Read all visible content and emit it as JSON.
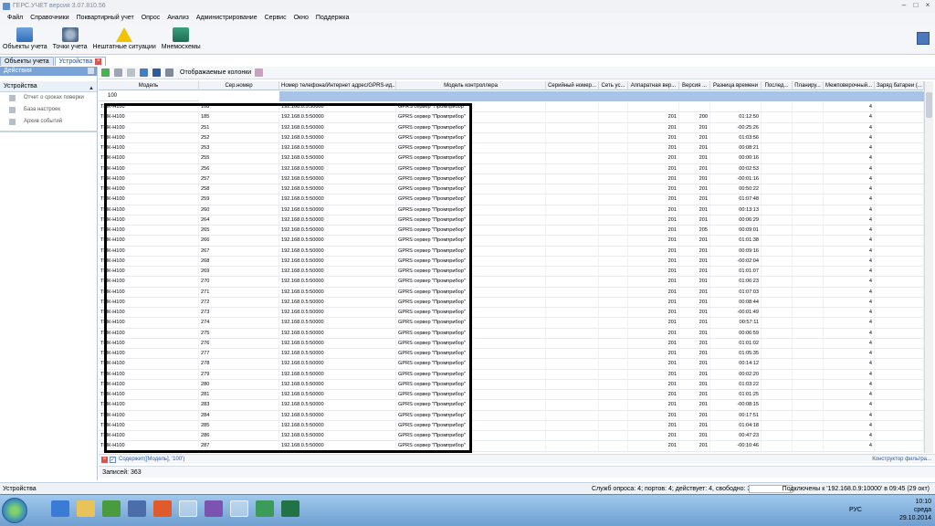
{
  "window": {
    "title": "ГЕРС.УЧЕТ версия 3.07.810.56"
  },
  "menu": [
    "Файл",
    "Справочники",
    "Поквартирный учет",
    "Опрос",
    "Анализ",
    "Администрирование",
    "Сервис",
    "Окно",
    "Поддержка"
  ],
  "toolbar": [
    {
      "label": "Объекты учета",
      "icon": "house-icon"
    },
    {
      "label": "Точки учета",
      "icon": "gear-meter-icon"
    },
    {
      "label": "Нештатные ситуации",
      "icon": "warning-icon"
    },
    {
      "label": "Мнемосхемы",
      "icon": "mnemo-icon"
    }
  ],
  "tabs": [
    {
      "label": "Объекты учета",
      "active": false
    },
    {
      "label": "Устройства",
      "active": true
    }
  ],
  "left_panel": {
    "header": "Действия",
    "section": "Устройства",
    "items": [
      {
        "label": "Отчет о сроках поверки"
      },
      {
        "label": "База настроек"
      },
      {
        "label": "Архив событий"
      }
    ]
  },
  "grid_toolbar": {
    "columns_label": "Отображаемые колонки"
  },
  "columns": [
    {
      "label": "Модель",
      "w": 110
    },
    {
      "label": "Сер.номер",
      "w": 88
    },
    {
      "label": "Номер телефона/Интернет адрес/GPRS-ид...",
      "w": 128
    },
    {
      "label": "Модель контроллера",
      "w": 164
    },
    {
      "label": "Серийный номер...",
      "w": 58
    },
    {
      "label": "Сеть ус...",
      "w": 32
    },
    {
      "label": "Аппаратная вер...",
      "w": 56
    },
    {
      "label": "Версия ...",
      "w": 34
    },
    {
      "label": "Разница времени",
      "w": 56
    },
    {
      "label": "Послед...",
      "w": 34
    },
    {
      "label": "Планиру...",
      "w": 34
    },
    {
      "label": "Межповерочный...",
      "w": 56
    },
    {
      "label": "Заряд батареи (...",
      "w": 54
    }
  ],
  "filter_value": "100",
  "rows": [
    [
      "ТМК-Н100",
      "108",
      "192.168.0.5:50000",
      "GPRS сервер \"Промприбор\"",
      "",
      "",
      "",
      "",
      "",
      "",
      "",
      "4",
      ""
    ],
    [
      "ТМК-Н100",
      "185",
      "192.168.0.5:50000",
      "GPRS сервер \"Промприбор\"",
      "",
      "",
      "201",
      "200",
      "01:12:50",
      "",
      "",
      "4",
      ""
    ],
    [
      "ТМК-Н100",
      "251",
      "192.168.0.5:50000",
      "GPRS сервер \"Промприбор\"",
      "",
      "",
      "201",
      "201",
      "-00:25:26",
      "",
      "",
      "4",
      ""
    ],
    [
      "ТМК-Н100",
      "252",
      "192.168.0.5:50000",
      "GPRS сервер \"Промприбор\"",
      "",
      "",
      "201",
      "201",
      "01:03:56",
      "",
      "",
      "4",
      ""
    ],
    [
      "ТМК-Н100",
      "253",
      "192.168.0.5:50000",
      "GPRS сервер \"Промприбор\"",
      "",
      "",
      "201",
      "201",
      "00:08:21",
      "",
      "",
      "4",
      ""
    ],
    [
      "ТМК-Н100",
      "255",
      "192.168.0.5:50000",
      "GPRS сервер \"Промприбор\"",
      "",
      "",
      "201",
      "201",
      "00:00:16",
      "",
      "",
      "4",
      ""
    ],
    [
      "ТМК-Н100",
      "256",
      "192.168.0.5:50000",
      "GPRS сервер \"Промприбор\"",
      "",
      "",
      "201",
      "201",
      "00:02:53",
      "",
      "",
      "4",
      ""
    ],
    [
      "ТМК-Н100",
      "257",
      "192.168.0.5:50000",
      "GPRS сервер \"Промприбор\"",
      "",
      "",
      "201",
      "201",
      "-00:01:16",
      "",
      "",
      "4",
      ""
    ],
    [
      "ТМК-Н100",
      "258",
      "192.168.0.5:50000",
      "GPRS сервер \"Промприбор\"",
      "",
      "",
      "201",
      "201",
      "00:50:22",
      "",
      "",
      "4",
      ""
    ],
    [
      "ТМК-Н100",
      "259",
      "192.168.0.5:50000",
      "GPRS сервер \"Промприбор\"",
      "",
      "",
      "201",
      "201",
      "01:07:48",
      "",
      "",
      "4",
      ""
    ],
    [
      "ТМК-Н100",
      "260",
      "192.168.0.5:50000",
      "GPRS сервер \"Промприбор\"",
      "",
      "",
      "201",
      "201",
      "00:13:13",
      "",
      "",
      "4",
      ""
    ],
    [
      "ТМК-Н100",
      "264",
      "192.168.0.5:50000",
      "GPRS сервер \"Промприбор\"",
      "",
      "",
      "201",
      "201",
      "00:06:29",
      "",
      "",
      "4",
      ""
    ],
    [
      "ТМК-Н100",
      "265",
      "192.168.0.5:50000",
      "GPRS сервер \"Промприбор\"",
      "",
      "",
      "201",
      "205",
      "00:09:01",
      "",
      "",
      "4",
      ""
    ],
    [
      "ТМК-Н100",
      "266",
      "192.168.0.5:50000",
      "GPRS сервер \"Промприбор\"",
      "",
      "",
      "201",
      "201",
      "01:01:38",
      "",
      "",
      "4",
      ""
    ],
    [
      "ТМК-Н100",
      "267",
      "192.168.0.5:50000",
      "GPRS сервер \"Промприбор\"",
      "",
      "",
      "201",
      "201",
      "00:09:16",
      "",
      "",
      "4",
      ""
    ],
    [
      "ТМК-Н100",
      "268",
      "192.168.0.5:50000",
      "GPRS сервер \"Промприбор\"",
      "",
      "",
      "201",
      "201",
      "-00:02:04",
      "",
      "",
      "4",
      ""
    ],
    [
      "ТМК-Н100",
      "269",
      "192.168.0.5:50000",
      "GPRS сервер \"Промприбор\"",
      "",
      "",
      "201",
      "201",
      "01:01:07",
      "",
      "",
      "4",
      ""
    ],
    [
      "ТМК-Н100",
      "270",
      "192.168.0.5:50000",
      "GPRS сервер \"Промприбор\"",
      "",
      "",
      "201",
      "201",
      "01:06:23",
      "",
      "",
      "4",
      ""
    ],
    [
      "ТМК-Н100",
      "271",
      "192.168.0.5:50000",
      "GPRS сервер \"Промприбор\"",
      "",
      "",
      "201",
      "201",
      "01:07:03",
      "",
      "",
      "4",
      ""
    ],
    [
      "ТМК-Н100",
      "272",
      "192.168.0.5:50000",
      "GPRS сервер \"Промприбор\"",
      "",
      "",
      "201",
      "201",
      "00:08:44",
      "",
      "",
      "4",
      ""
    ],
    [
      "ТМК-Н100",
      "273",
      "192.168.0.5:50000",
      "GPRS сервер \"Промприбор\"",
      "",
      "",
      "201",
      "201",
      "-00:01:49",
      "",
      "",
      "4",
      ""
    ],
    [
      "ТМК-Н100",
      "274",
      "192.168.0.5:50000",
      "GPRS сервер \"Промприбор\"",
      "",
      "",
      "201",
      "201",
      "00:57:11",
      "",
      "",
      "4",
      ""
    ],
    [
      "ТМК-Н100",
      "275",
      "192.168.0.5:50000",
      "GPRS сервер \"Промприбор\"",
      "",
      "",
      "201",
      "201",
      "00:06:59",
      "",
      "",
      "4",
      ""
    ],
    [
      "ТМК-Н100",
      "276",
      "192.168.0.5:50000",
      "GPRS сервер \"Промприбор\"",
      "",
      "",
      "201",
      "201",
      "01:01:02",
      "",
      "",
      "4",
      ""
    ],
    [
      "ТМК-Н100",
      "277",
      "192.168.0.5:50000",
      "GPRS сервер \"Промприбор\"",
      "",
      "",
      "201",
      "201",
      "01:05:35",
      "",
      "",
      "4",
      ""
    ],
    [
      "ТМК-Н100",
      "278",
      "192.168.0.5:50000",
      "GPRS сервер \"Промприбор\"",
      "",
      "",
      "201",
      "201",
      "00:14:12",
      "",
      "",
      "4",
      ""
    ],
    [
      "ТМК-Н100",
      "279",
      "192.168.0.5:50000",
      "GPRS сервер \"Промприбор\"",
      "",
      "",
      "201",
      "201",
      "00:02:20",
      "",
      "",
      "4",
      ""
    ],
    [
      "ТМК-Н100",
      "280",
      "192.168.0.5:50000",
      "GPRS сервер \"Промприбор\"",
      "",
      "",
      "201",
      "201",
      "01:03:22",
      "",
      "",
      "4",
      ""
    ],
    [
      "ТМК-Н100",
      "281",
      "192.168.0.5:50000",
      "GPRS сервер \"Промприбор\"",
      "",
      "",
      "201",
      "201",
      "01:01:25",
      "",
      "",
      "4",
      ""
    ],
    [
      "ТМК-Н100",
      "283",
      "192.168.0.5:50000",
      "GPRS сервер \"Промприбор\"",
      "",
      "",
      "201",
      "201",
      "-00:08:15",
      "",
      "",
      "4",
      ""
    ],
    [
      "ТМК-Н100",
      "284",
      "192.168.0.5:50000",
      "GPRS сервер \"Промприбор\"",
      "",
      "",
      "201",
      "201",
      "00:17:51",
      "",
      "",
      "4",
      ""
    ],
    [
      "ТМК-Н100",
      "285",
      "192.168.0.5:50000",
      "GPRS сервер \"Промприбор\"",
      "",
      "",
      "201",
      "201",
      "01:04:18",
      "",
      "",
      "4",
      ""
    ],
    [
      "ТМК-Н100",
      "286",
      "192.168.0.5:50000",
      "GPRS сервер \"Промприбор\"",
      "",
      "",
      "201",
      "201",
      "00:47:23",
      "",
      "",
      "4",
      ""
    ],
    [
      "ТМК-Н100",
      "287",
      "192.168.0.5:50000",
      "GPRS сервер \"Промприбор\"",
      "",
      "",
      "201",
      "201",
      "-00:10:46",
      "",
      "",
      "4",
      ""
    ]
  ],
  "filter_expression": "Содержит([Модель], '100')",
  "filter_builder_label": "Конструктор фильтра...",
  "record_count": "Записей: 363",
  "status": {
    "left": "Устройства",
    "middle": "Служб опроса: 4; портов: 4; действует: 4, свободно: 3",
    "right": "Подключены к '192.168.0.9:10000' в 09:45 (29 окт)"
  },
  "taskbar": {
    "lang": "РУС",
    "time": "10:10",
    "day": "среда",
    "date": "29.10.2014"
  },
  "colors": {
    "selection": "#8fb0dc",
    "accent": "#2b5ea7",
    "highlight_border": "#000000"
  }
}
